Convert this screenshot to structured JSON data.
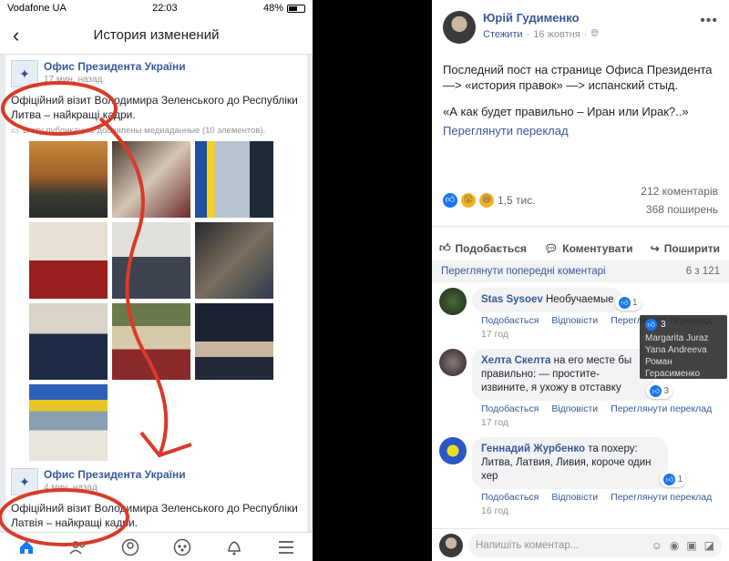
{
  "left": {
    "status": {
      "carrier": "Vodafone UA",
      "time": "22:03",
      "battery": "48%"
    },
    "nav": {
      "back": "‹",
      "title": "История изменений"
    },
    "post1": {
      "name": "Офис Президента України",
      "time": "17 мин. назад",
      "text": "Офіційний візит Володимира Зеленського до Республіки Литва – найкращі кадри.",
      "note": "В эту публикацию добавлены медиаданные (10 элементов)."
    },
    "post2": {
      "name": "Офис Президента України",
      "time": "4 мин. назад",
      "text": "Офіційний візит Володимира Зеленського до Республіки Латвія – найкращі кадри."
    },
    "tabs": [
      "home-icon",
      "friends-icon",
      "profile-icon",
      "groups-icon",
      "bell-icon",
      "menu-icon"
    ]
  },
  "right": {
    "author": "Юрій Гудименко",
    "follow": "Стежити",
    "date": "16 жовтня",
    "text1": "Последний пост на странице Офиса Президента —> «история правок» —> испанский стыд.",
    "text2": "«А как будет правильно – Иран или Ирак?..»",
    "translate": "Переглянути переклад",
    "reactions": "1,5 тис.",
    "comments_count": "212 коментарів",
    "shares": "368 поширень",
    "actions": {
      "like": "Подобається",
      "comment": "Коментувати",
      "share": "Поширити"
    },
    "prev_comments": "Переглянути попередні коментарі",
    "prev_count": "6 з 121",
    "comments": [
      {
        "name": "Stas Sysoev",
        "text": "Необучаемые",
        "likes": "1",
        "time": "17 год",
        "like": "Подобається",
        "reply": "Відповісти",
        "translate": "Переглянути переклад"
      },
      {
        "name": "Хелта Скелта",
        "text": "на его месте бы правильно: — простите-извините, я ухожу в отставку",
        "likes": "3",
        "time": "17 год",
        "like": "Подобається",
        "reply": "Відповісти",
        "translate": "Переглянути переклад"
      },
      {
        "name": "Геннадий Журбенко",
        "text": "та похеру: Литва, Латвия, Ливия, короче один хер",
        "likes": "1",
        "time": "16 год",
        "like": "Подобається",
        "reply": "Відповісти",
        "translate": "Переглянути переклад"
      }
    ],
    "tooltip": {
      "count": "3",
      "names": [
        "Margarita Juraz",
        "Yana Andreeva",
        "Роман Герасименко"
      ]
    },
    "composer_placeholder": "Напишіть коментар..."
  }
}
